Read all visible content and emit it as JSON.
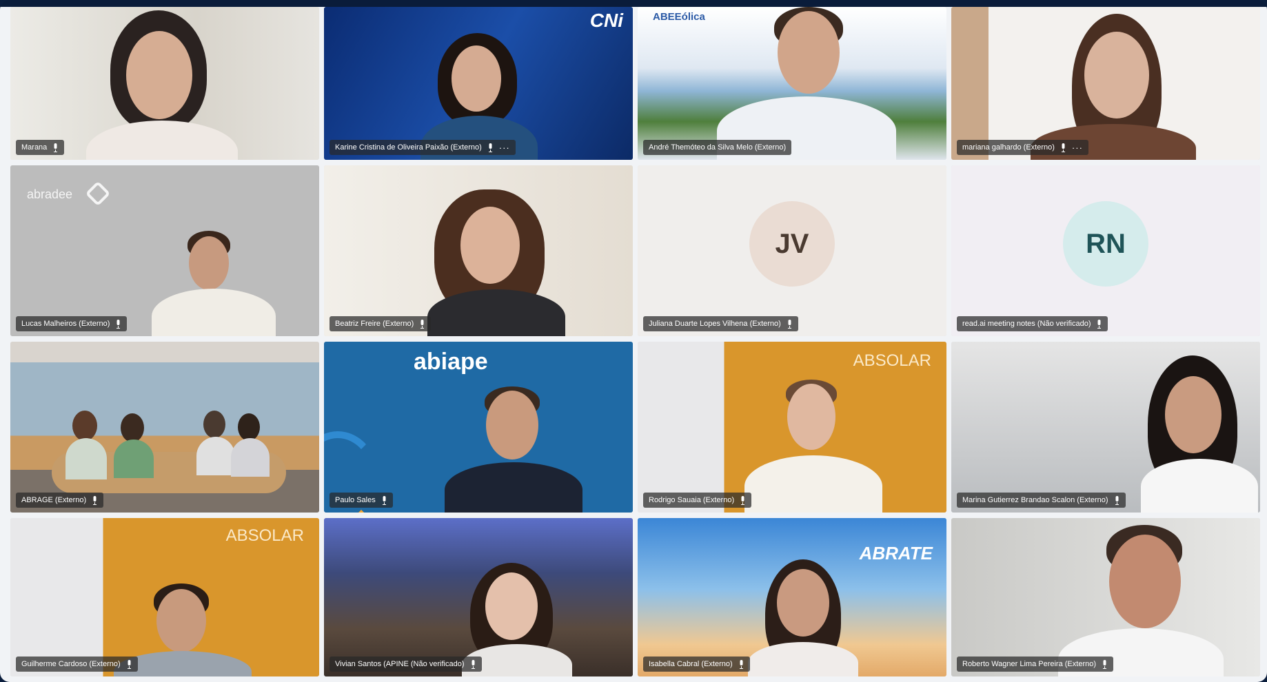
{
  "participants": [
    {
      "name": "Marana",
      "avatar": null,
      "has_more": false
    },
    {
      "name": "Karine Cristina de Oliveira Paixão (Externo)",
      "avatar": null,
      "has_more": true,
      "logo": "CNi"
    },
    {
      "name": "André Themóteo da Silva Melo (Externo)",
      "avatar": null,
      "has_more": false,
      "logo": "ABEEólica"
    },
    {
      "name": "mariana galhardo (Externo)",
      "avatar": null,
      "has_more": true
    },
    {
      "name": "Lucas Malheiros (Externo)",
      "avatar": null,
      "has_more": false,
      "logo": "abradee"
    },
    {
      "name": "Beatriz Freire (Externo)",
      "avatar": null,
      "has_more": false
    },
    {
      "name": "Juliana Duarte Lopes Vilhena (Externo)",
      "avatar": "JV",
      "has_more": false
    },
    {
      "name": "read.ai meeting notes (Não verificado)",
      "avatar": "RN",
      "has_more": false
    },
    {
      "name": "ABRAGE (Externo)",
      "avatar": null,
      "has_more": false
    },
    {
      "name": "Paulo Sales",
      "avatar": null,
      "has_more": false,
      "logo": "abiape"
    },
    {
      "name": "Rodrigo Sauaia (Externo)",
      "avatar": null,
      "has_more": false,
      "logo": "ABSOLAR"
    },
    {
      "name": "Marina Gutierrez Brandao Scalon (Externo)",
      "avatar": null,
      "has_more": false
    },
    {
      "name": "Guilherme Cardoso (Externo)",
      "avatar": null,
      "has_more": false,
      "logo": "ABSOLAR"
    },
    {
      "name": "Vivian Santos (APINE (Não verificado)",
      "avatar": null,
      "has_more": false
    },
    {
      "name": "Isabella Cabral (Externo)",
      "avatar": null,
      "has_more": false,
      "logo": "ABRATE"
    },
    {
      "name": "Roberto Wagner Lima Pereira (Externo)",
      "avatar": null,
      "has_more": false
    }
  ],
  "colors": {
    "window_frame": "#0a1c3a",
    "nameplate_bg": "#282828",
    "abiape_blue": "#1f6aa5",
    "absolar_orange": "#d9962c"
  }
}
